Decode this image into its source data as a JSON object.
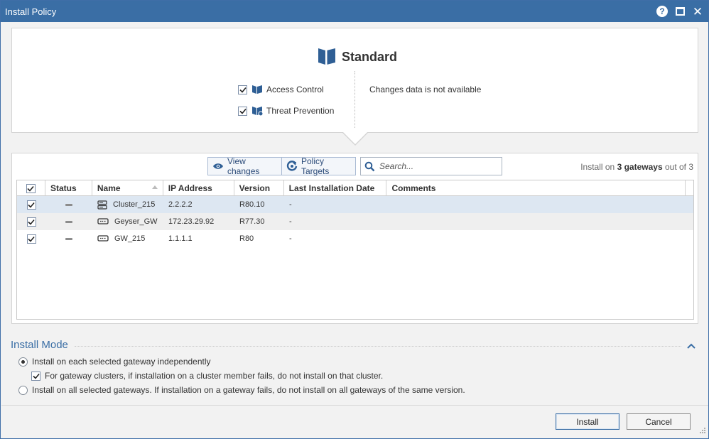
{
  "window": {
    "title": "Install Policy"
  },
  "policy": {
    "name": "Standard",
    "blades": [
      {
        "label": "Access Control",
        "checked": true,
        "icon": "access-control-icon"
      },
      {
        "label": "Threat Prevention",
        "checked": true,
        "icon": "threat-prevention-icon"
      }
    ],
    "changes_text": "Changes data is not available"
  },
  "toolbar": {
    "view_changes_label": "View changes",
    "policy_targets_label": "Policy Targets",
    "search_placeholder": "Search...",
    "install_on_prefix": "Install on",
    "install_on_count": "3 gateways",
    "install_on_suffix": "out of 3"
  },
  "table": {
    "columns": [
      "Status",
      "Name",
      "IP Address",
      "Version",
      "Last Installation Date",
      "Comments"
    ],
    "rows": [
      {
        "checked": true,
        "status": "none",
        "name": "Cluster_215",
        "type": "cluster-icon",
        "ip": "2.2.2.2",
        "version": "R80.10",
        "last_install": "-",
        "comments": ""
      },
      {
        "checked": true,
        "status": "none",
        "name": "Geyser_GW",
        "type": "gateway-icon",
        "ip": "172.23.29.92",
        "version": "R77.30",
        "last_install": "-",
        "comments": ""
      },
      {
        "checked": true,
        "status": "none",
        "name": "GW_215",
        "type": "gateway-icon",
        "ip": "1.1.1.1",
        "version": "R80",
        "last_install": "-",
        "comments": ""
      }
    ]
  },
  "install_mode": {
    "title": "Install Mode",
    "option_each": "Install on each selected gateway independently",
    "option_each_selected": true,
    "cluster_sub_option": "For gateway clusters, if installation on a cluster member fails, do not install on that cluster.",
    "cluster_sub_checked": true,
    "option_all": "Install on all selected gateways. If installation on a gateway fails, do not install on all gateways of the same version.",
    "option_all_selected": false
  },
  "footer": {
    "install_label": "Install",
    "cancel_label": "Cancel"
  },
  "colors": {
    "accent": "#3a6ea5",
    "selected_row": "#dde7f2",
    "alt_row": "#efefef"
  }
}
